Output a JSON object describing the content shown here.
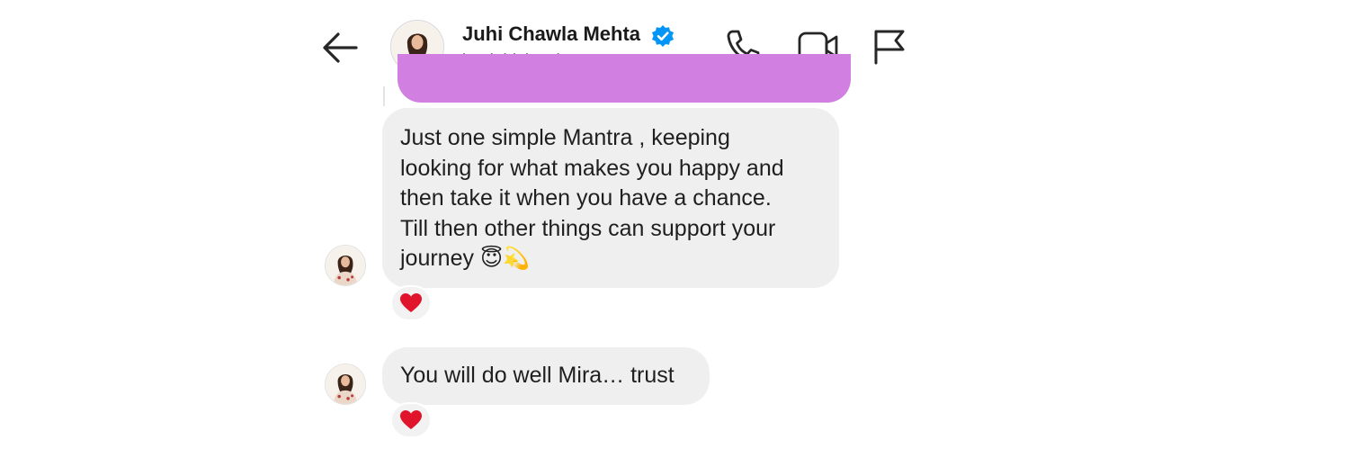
{
  "header": {
    "name": "Juhi Chawla Mehta",
    "handle": "iamjuhichawla",
    "verified": true,
    "icons": [
      "back-arrow-icon",
      "phone-icon",
      "video-camera-icon",
      "flag-icon"
    ]
  },
  "messages": [
    {
      "sender": "iamjuhichawla",
      "lines": [
        "Just one simple Mantra , keeping",
        "looking for what makes you happy and",
        "then take it when you have a chance.",
        "Till then other things can support your",
        "journey"
      ],
      "emojis": "😇💫",
      "reaction": "heart"
    },
    {
      "sender": "iamjuhichawla",
      "text": "You will do well Mira… trust",
      "reaction": "heart"
    }
  ],
  "colors": {
    "sent_bubble": "#d17fe0",
    "received_bubble": "#efefef",
    "verified_badge": "#0095f6",
    "heart": "#e0142a"
  }
}
